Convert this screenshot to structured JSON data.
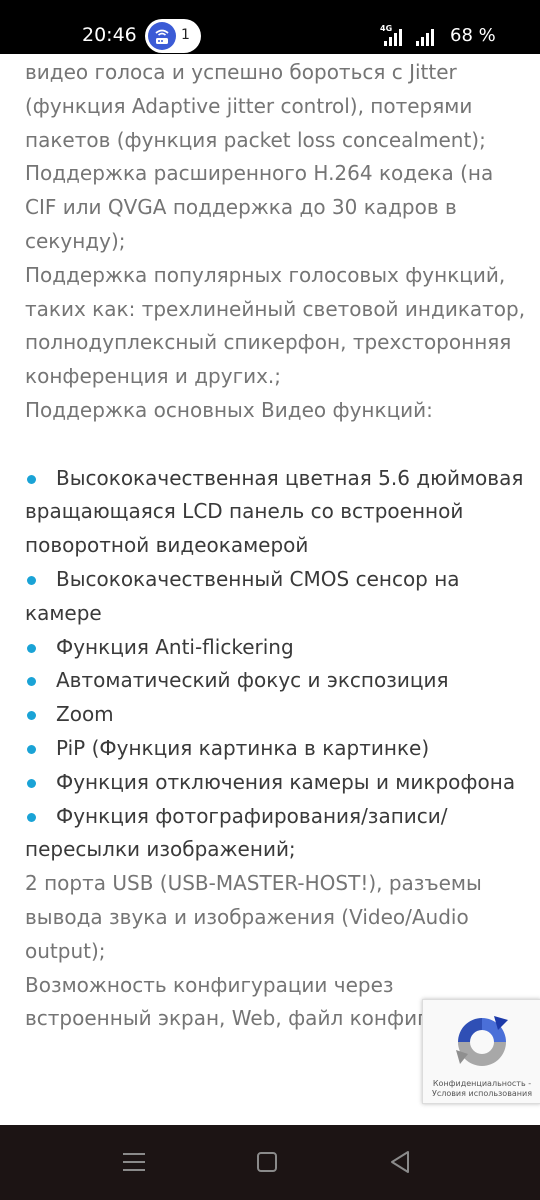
{
  "status_bar": {
    "time": "20:46",
    "notification_count": "1",
    "network_type": "4G",
    "battery_percent": "68 %"
  },
  "article": {
    "lines": [
      "видео голоса и успешно бороться с Jitter",
      "(функция Adaptive jitter control), потерями",
      "пакетов (функция packet loss concealment);",
      "Поддержка расширенного H.264 кодека (на",
      "CIF или QVGA поддержка до 30 кадров в",
      "секунду);",
      "Поддержка популярных голосовых функций,",
      "таких как: трехлинейный световой индикатор,",
      "полнодуплексный спикерфон, трехсторонняя",
      "конференция и других.;",
      "Поддержка основных Видео функций:"
    ],
    "bullets": [
      {
        "lines": [
          "Высококачественная цветная 5.6 дюймовая",
          "вращающаяся LCD панель со встроенной",
          "поворотной видеокамерой"
        ]
      },
      {
        "lines": [
          "Высококачественный CMOS сенсор на",
          "камере"
        ]
      },
      {
        "lines": [
          "Функция Anti-flickering"
        ]
      },
      {
        "lines": [
          "Автоматический фокус и экспозиция"
        ]
      },
      {
        "lines": [
          "Zoom"
        ]
      },
      {
        "lines": [
          "PiP (Функция картинка в картинке)"
        ]
      },
      {
        "lines": [
          "Функция отключения камеры и микрофона"
        ]
      },
      {
        "lines": [
          "Функция фотографирования/записи/",
          "пересылки изображений;"
        ]
      }
    ],
    "tail_lines": [
      "2 порта USB (USB-MASTER-HOST!), разъемы",
      "вывода звука и изображения (Video/Audio",
      "output);",
      "Возможность конфигурации через",
      "встроенный экран, Web, файл конфигу"
    ]
  },
  "recaptcha": {
    "privacy": "Конфиденциальность",
    "terms": "Условия использования",
    "separator": " - "
  },
  "colors": {
    "bullet": "#1aa3d6",
    "text_muted": "#757575",
    "text_dark": "#3a3a3a",
    "nav_bar": "#1c1414"
  },
  "icons": {
    "notification": "wifi-router-icon",
    "nav_recents": "recents-icon",
    "nav_home": "home-icon",
    "nav_back": "back-icon"
  }
}
